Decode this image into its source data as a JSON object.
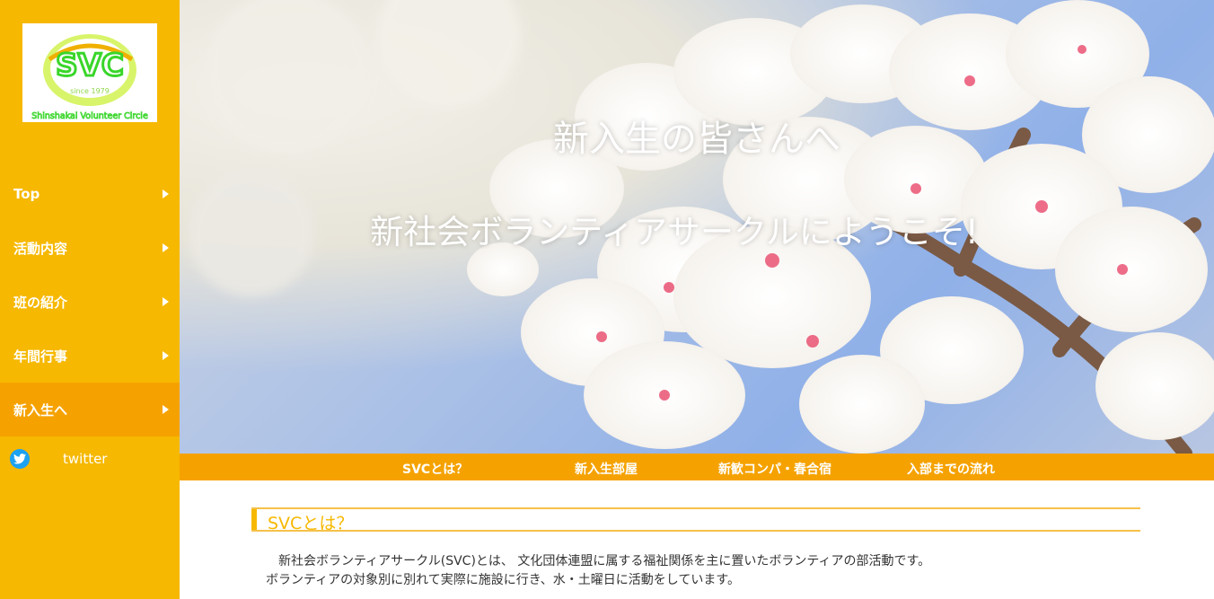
{
  "logo": {
    "mark": "SVC",
    "since": "since 1979",
    "tagline": "Shinshakai Volunteer Circle"
  },
  "sidebar": {
    "items": [
      {
        "label": "Top"
      },
      {
        "label": "活動内容"
      },
      {
        "label": "班の紹介"
      },
      {
        "label": "年間行事"
      },
      {
        "label": "新入生へ",
        "active": true
      }
    ],
    "twitter": {
      "label": "twitter",
      "icon": "twitter-icon"
    }
  },
  "hero": {
    "title": "新入生の皆さんへ",
    "subtitle": "新社会ボランティアサークルにようこそ!"
  },
  "subnav": {
    "items": [
      {
        "label": "SVCとは？"
      },
      {
        "label": "新入生部屋"
      },
      {
        "label": "新歓コンパ・春合宿"
      },
      {
        "label": "入部までの流れ"
      }
    ]
  },
  "section": {
    "title": "SVCとは？",
    "paragraph_1": "新社会ボランティアサークル(SVC)とは、 文化団体連盟に属する福祉関係を主に置いたボランティアの部活動です。",
    "paragraph_2": "ボランティアの対象別に別れて実際に施設に行き、水・土曜日に活動をしています。"
  },
  "colors": {
    "sidebar": "#f6b800",
    "active": "#f5a200",
    "accent_green": "#39d62a",
    "twitter_blue": "#1da1f2"
  }
}
